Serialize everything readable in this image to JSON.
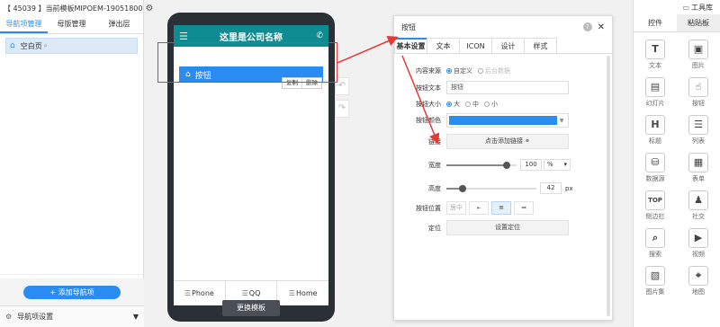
{
  "left_panel": {
    "title": "【 45039 】当前模板MIPOEM-19051800",
    "tabs": [
      "导航项管理",
      "母版管理",
      "弹出层"
    ],
    "nav_item": {
      "label": "空白页",
      "suffix": "⌕"
    },
    "add_button": "+ 添加导航项",
    "bottom_label": "导航项设置"
  },
  "phone": {
    "header_title": "这里是公司名称",
    "button_label": "按钮",
    "ops": {
      "copy": "复制",
      "delete": "删除"
    },
    "footer": [
      "Phone",
      "QQ",
      "Home"
    ],
    "switch_template": "更换模板"
  },
  "dialog": {
    "title": "按钮",
    "tabs": [
      "基本设置",
      "文本",
      "ICON",
      "设计",
      "样式"
    ],
    "content_source": {
      "label": "内容来源",
      "options": [
        "自定义",
        "后台数据"
      ]
    },
    "button_text": {
      "label": "按钮文本",
      "value": "按钮"
    },
    "button_size": {
      "label": "按钮大小",
      "options": [
        "大",
        "中",
        "小"
      ]
    },
    "button_color": {
      "label": "按钮颜色",
      "value": "#2a8cf0"
    },
    "link": {
      "label": "链接",
      "button": "点击添加链接"
    },
    "width": {
      "label": "宽度",
      "value": "100",
      "unit": "%",
      "fraction": 0.9
    },
    "height": {
      "label": "高度",
      "value": "42",
      "unit": "px",
      "fraction": 0.15
    },
    "button_position": {
      "label": "按钮位置",
      "options": [
        "居中",
        "左",
        "中",
        "右"
      ]
    },
    "locate": {
      "label": "定位",
      "button": "设置定位"
    }
  },
  "toolbox": {
    "title": "工具库",
    "tabs": [
      "控件",
      "粘贴板"
    ],
    "items": [
      {
        "label": "文本",
        "icon": "text-icon",
        "glyph": "T"
      },
      {
        "label": "图片",
        "icon": "image-icon",
        "glyph": "▣"
      },
      {
        "label": "幻灯片",
        "icon": "slideshow-icon",
        "glyph": "▤"
      },
      {
        "label": "按钮",
        "icon": "button-icon",
        "glyph": "☝"
      },
      {
        "label": "标题",
        "icon": "heading-icon",
        "glyph": "H"
      },
      {
        "label": "列表",
        "icon": "list-icon",
        "glyph": "☰"
      },
      {
        "label": "数据源",
        "icon": "database-icon",
        "glyph": "⛁"
      },
      {
        "label": "表单",
        "icon": "form-icon",
        "glyph": "▦"
      },
      {
        "label": "侧边栏",
        "icon": "sidebar-icon",
        "glyph": "TOP"
      },
      {
        "label": "社交",
        "icon": "social-icon",
        "glyph": "♟"
      },
      {
        "label": "搜索",
        "icon": "search-icon",
        "glyph": "⌕"
      },
      {
        "label": "视频",
        "icon": "video-icon",
        "glyph": "▶"
      },
      {
        "label": "图片集",
        "icon": "gallery-icon",
        "glyph": "▧"
      },
      {
        "label": "地图",
        "icon": "map-icon",
        "glyph": "⌖"
      }
    ]
  }
}
